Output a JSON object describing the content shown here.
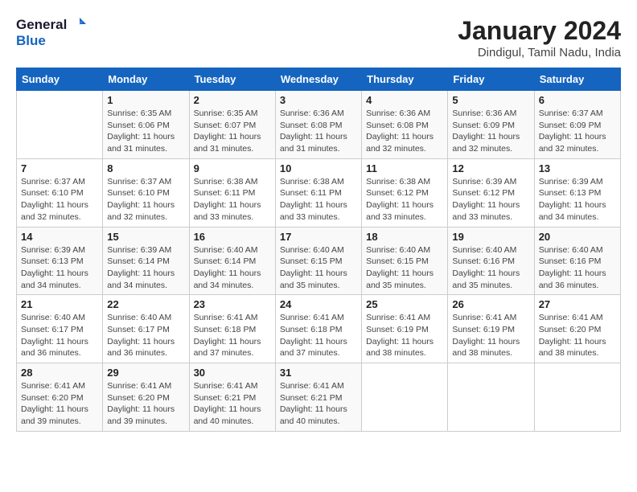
{
  "header": {
    "logo_line1": "General",
    "logo_line2": "Blue",
    "title": "January 2024",
    "subtitle": "Dindigul, Tamil Nadu, India"
  },
  "calendar": {
    "weekdays": [
      "Sunday",
      "Monday",
      "Tuesday",
      "Wednesday",
      "Thursday",
      "Friday",
      "Saturday"
    ],
    "weeks": [
      [
        {
          "day": "",
          "text": ""
        },
        {
          "day": "1",
          "text": "Sunrise: 6:35 AM\nSunset: 6:06 PM\nDaylight: 11 hours and 31 minutes."
        },
        {
          "day": "2",
          "text": "Sunrise: 6:35 AM\nSunset: 6:07 PM\nDaylight: 11 hours and 31 minutes."
        },
        {
          "day": "3",
          "text": "Sunrise: 6:36 AM\nSunset: 6:08 PM\nDaylight: 11 hours and 31 minutes."
        },
        {
          "day": "4",
          "text": "Sunrise: 6:36 AM\nSunset: 6:08 PM\nDaylight: 11 hours and 32 minutes."
        },
        {
          "day": "5",
          "text": "Sunrise: 6:36 AM\nSunset: 6:09 PM\nDaylight: 11 hours and 32 minutes."
        },
        {
          "day": "6",
          "text": "Sunrise: 6:37 AM\nSunset: 6:09 PM\nDaylight: 11 hours and 32 minutes."
        }
      ],
      [
        {
          "day": "7",
          "text": "Sunrise: 6:37 AM\nSunset: 6:10 PM\nDaylight: 11 hours and 32 minutes."
        },
        {
          "day": "8",
          "text": "Sunrise: 6:37 AM\nSunset: 6:10 PM\nDaylight: 11 hours and 32 minutes."
        },
        {
          "day": "9",
          "text": "Sunrise: 6:38 AM\nSunset: 6:11 PM\nDaylight: 11 hours and 33 minutes."
        },
        {
          "day": "10",
          "text": "Sunrise: 6:38 AM\nSunset: 6:11 PM\nDaylight: 11 hours and 33 minutes."
        },
        {
          "day": "11",
          "text": "Sunrise: 6:38 AM\nSunset: 6:12 PM\nDaylight: 11 hours and 33 minutes."
        },
        {
          "day": "12",
          "text": "Sunrise: 6:39 AM\nSunset: 6:12 PM\nDaylight: 11 hours and 33 minutes."
        },
        {
          "day": "13",
          "text": "Sunrise: 6:39 AM\nSunset: 6:13 PM\nDaylight: 11 hours and 34 minutes."
        }
      ],
      [
        {
          "day": "14",
          "text": "Sunrise: 6:39 AM\nSunset: 6:13 PM\nDaylight: 11 hours and 34 minutes."
        },
        {
          "day": "15",
          "text": "Sunrise: 6:39 AM\nSunset: 6:14 PM\nDaylight: 11 hours and 34 minutes."
        },
        {
          "day": "16",
          "text": "Sunrise: 6:40 AM\nSunset: 6:14 PM\nDaylight: 11 hours and 34 minutes."
        },
        {
          "day": "17",
          "text": "Sunrise: 6:40 AM\nSunset: 6:15 PM\nDaylight: 11 hours and 35 minutes."
        },
        {
          "day": "18",
          "text": "Sunrise: 6:40 AM\nSunset: 6:15 PM\nDaylight: 11 hours and 35 minutes."
        },
        {
          "day": "19",
          "text": "Sunrise: 6:40 AM\nSunset: 6:16 PM\nDaylight: 11 hours and 35 minutes."
        },
        {
          "day": "20",
          "text": "Sunrise: 6:40 AM\nSunset: 6:16 PM\nDaylight: 11 hours and 36 minutes."
        }
      ],
      [
        {
          "day": "21",
          "text": "Sunrise: 6:40 AM\nSunset: 6:17 PM\nDaylight: 11 hours and 36 minutes."
        },
        {
          "day": "22",
          "text": "Sunrise: 6:40 AM\nSunset: 6:17 PM\nDaylight: 11 hours and 36 minutes."
        },
        {
          "day": "23",
          "text": "Sunrise: 6:41 AM\nSunset: 6:18 PM\nDaylight: 11 hours and 37 minutes."
        },
        {
          "day": "24",
          "text": "Sunrise: 6:41 AM\nSunset: 6:18 PM\nDaylight: 11 hours and 37 minutes."
        },
        {
          "day": "25",
          "text": "Sunrise: 6:41 AM\nSunset: 6:19 PM\nDaylight: 11 hours and 38 minutes."
        },
        {
          "day": "26",
          "text": "Sunrise: 6:41 AM\nSunset: 6:19 PM\nDaylight: 11 hours and 38 minutes."
        },
        {
          "day": "27",
          "text": "Sunrise: 6:41 AM\nSunset: 6:20 PM\nDaylight: 11 hours and 38 minutes."
        }
      ],
      [
        {
          "day": "28",
          "text": "Sunrise: 6:41 AM\nSunset: 6:20 PM\nDaylight: 11 hours and 39 minutes."
        },
        {
          "day": "29",
          "text": "Sunrise: 6:41 AM\nSunset: 6:20 PM\nDaylight: 11 hours and 39 minutes."
        },
        {
          "day": "30",
          "text": "Sunrise: 6:41 AM\nSunset: 6:21 PM\nDaylight: 11 hours and 40 minutes."
        },
        {
          "day": "31",
          "text": "Sunrise: 6:41 AM\nSunset: 6:21 PM\nDaylight: 11 hours and 40 minutes."
        },
        {
          "day": "",
          "text": ""
        },
        {
          "day": "",
          "text": ""
        },
        {
          "day": "",
          "text": ""
        }
      ]
    ]
  }
}
